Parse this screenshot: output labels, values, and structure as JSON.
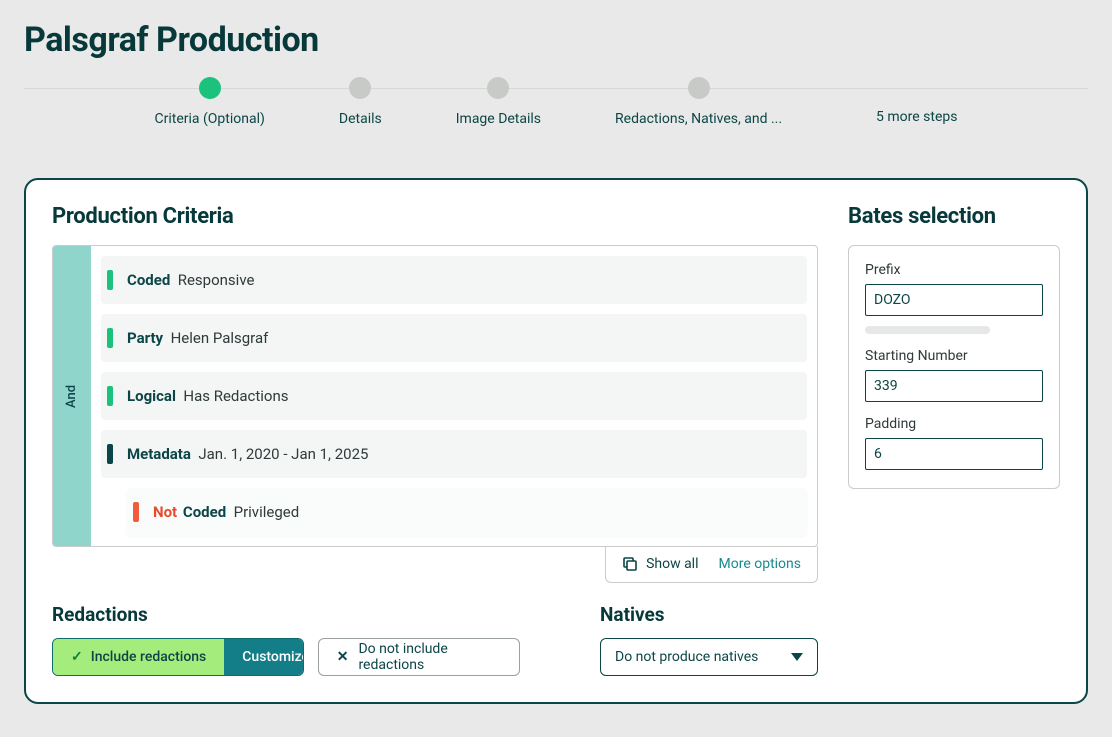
{
  "page": {
    "title": "Palsgraf Production"
  },
  "stepper": {
    "steps": [
      {
        "label": "Criteria (Optional)",
        "active": true
      },
      {
        "label": "Details",
        "active": false
      },
      {
        "label": "Image Details",
        "active": false
      },
      {
        "label": "Redactions, Natives, and ...",
        "active": false
      }
    ],
    "more": "5 more steps"
  },
  "criteria": {
    "heading": "Production Criteria",
    "operator": "And",
    "rows": [
      {
        "field": "Coded",
        "value": "Responsive",
        "accent": "green"
      },
      {
        "field": "Party",
        "value": "Helen Palsgraf",
        "accent": "green"
      },
      {
        "field": "Logical",
        "value": "Has Redactions",
        "accent": "green"
      },
      {
        "field": "Metadata",
        "value": "Jan. 1, 2020 - Jan 1, 2025",
        "accent": "dark"
      }
    ],
    "nested": {
      "not": "Not",
      "field": "Coded",
      "value": "Privileged"
    },
    "show_all": "Show all",
    "more_options": "More options"
  },
  "redactions": {
    "heading": "Redactions",
    "include_label": "Include redactions",
    "customize_label": "Customize",
    "exclude_label": "Do not include redactions"
  },
  "natives": {
    "heading": "Natives",
    "selected": "Do not produce natives"
  },
  "bates": {
    "heading": "Bates selection",
    "prefix_label": "Prefix",
    "prefix_value": "DOZO",
    "start_label": "Starting Number",
    "start_value": "339",
    "padding_label": "Padding",
    "padding_value": "6"
  }
}
